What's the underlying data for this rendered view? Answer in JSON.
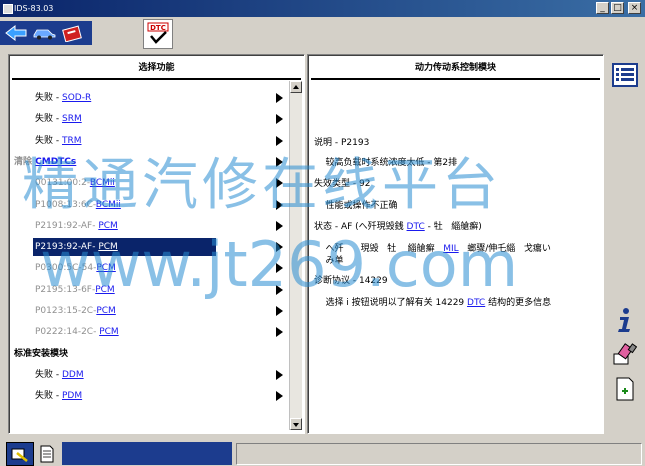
{
  "window": {
    "title": "IDS-83.03"
  },
  "toolbar": {
    "icons": [
      "back-arrow-icon",
      "vehicle-icon",
      "toolbox-icon"
    ],
    "dtc_label": "DTC"
  },
  "left_panel": {
    "header": "选择功能",
    "rows": [
      {
        "prefix": "失败 - ",
        "link": "SOD-R",
        "arrow": true,
        "style": "normal"
      },
      {
        "prefix": "失败 - ",
        "link": "SRM",
        "arrow": true,
        "style": "normal"
      },
      {
        "prefix": "失败 - ",
        "link": "TRM",
        "arrow": true,
        "style": "normal"
      },
      {
        "prefix": "清除 ",
        "link": "CMDTCs",
        "arrow": true,
        "style": "grey-sec"
      },
      {
        "prefix": "00131:00:2-",
        "link": "BCMii",
        "arrow": true,
        "style": "grey"
      },
      {
        "prefix": "P1008:13:6C-",
        "link": "BCMii",
        "arrow": true,
        "style": "grey"
      },
      {
        "prefix": "P2191:92-AF- ",
        "link": "PCM",
        "arrow": true,
        "style": "grey"
      },
      {
        "prefix": "P2193:92-AF- ",
        "link": "PCM",
        "arrow": true,
        "style": "selected"
      },
      {
        "prefix": "P0300:5C-54-",
        "link": "PCM",
        "arrow": true,
        "style": "grey"
      },
      {
        "prefix": "P2195:13-6F-",
        "link": "PCM",
        "arrow": true,
        "style": "grey"
      },
      {
        "prefix": "P0123:15-2C-",
        "link": "PCM",
        "arrow": true,
        "style": "grey"
      },
      {
        "prefix": "P0222:14-2C- ",
        "link": "PCM",
        "arrow": true,
        "style": "grey"
      },
      {
        "prefix": "标准安装模块",
        "link": "",
        "arrow": false,
        "style": "section"
      },
      {
        "prefix": "失败 - ",
        "link": "DDM",
        "arrow": true,
        "style": "normal"
      },
      {
        "prefix": "失败 - ",
        "link": "PDM",
        "arrow": true,
        "style": "normal"
      }
    ]
  },
  "right_panel": {
    "header": "动力传动系控制模块",
    "lines": [
      {
        "text": "说明 - P2193",
        "link": "",
        "after": ""
      },
      {
        "text": "    较高负载时系统浓度太低 - 第2排",
        "link": "",
        "after": ""
      },
      {
        "text": "失效类型 - 92",
        "link": "",
        "after": ""
      },
      {
        "text": "    性能或操作不正确",
        "link": "",
        "after": ""
      },
      {
        "text": "状态 - AF (へ歼現毁銭 ",
        "link": "DTC",
        "after": " - 牡   緇艙癬)"
      },
      {
        "text": "    へ歼      現毁   牡    緇艙癬   ",
        "link": "MIL",
        "after": "   螂骤/伸乇緇   戈癟い"
      },
      {
        "text": "    み单",
        "link": "",
        "after": ""
      },
      {
        "text": "诊断协议 - 14229",
        "link": "",
        "after": ""
      },
      {
        "text": "    选择 i 按钮说明以了解有关 14229 ",
        "link": "DTC",
        "after": " 结构的更多信息"
      }
    ]
  },
  "side_icons": [
    "list-icon",
    "info-icon",
    "eraser-icon",
    "report-icon"
  ],
  "watermark": {
    "line1": "精通汽修在线平台",
    "line2": "www.jt269.com"
  }
}
